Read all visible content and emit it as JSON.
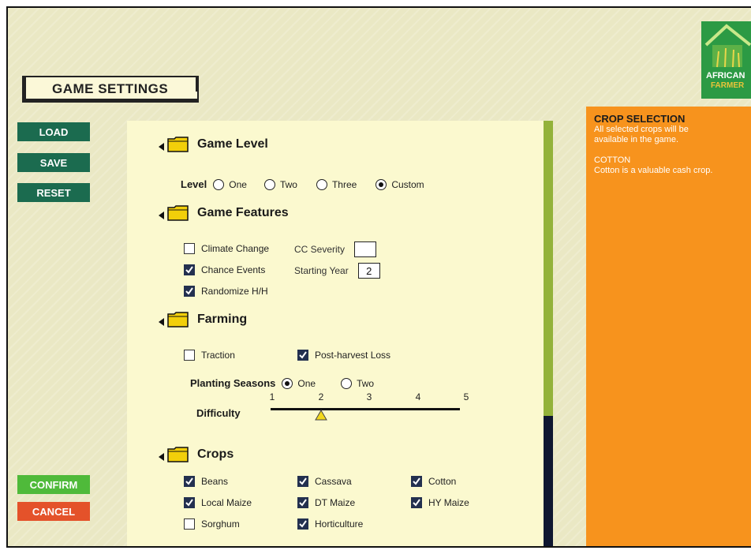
{
  "title": "GAME SETTINGS",
  "buttons": {
    "load": "LOAD",
    "save": "SAVE",
    "reset": "RESET",
    "confirm": "CONFIRM",
    "cancel": "CANCEL"
  },
  "game_level": {
    "heading": "Game Level",
    "label": "Level",
    "options": [
      "One",
      "Two",
      "Three",
      "Custom"
    ],
    "selected": "Custom"
  },
  "game_features": {
    "heading": "Game Features",
    "climate_change": {
      "label": "Climate Change",
      "checked": false
    },
    "chance_events": {
      "label": "Chance Events",
      "checked": true
    },
    "randomize": {
      "label": "Randomize H/H",
      "checked": true
    },
    "cc_severity": {
      "label": "CC Severity",
      "value": ""
    },
    "starting_year": {
      "label": "Starting Year",
      "value": "2"
    }
  },
  "farming": {
    "heading": "Farming",
    "traction": {
      "label": "Traction",
      "checked": false
    },
    "post_harvest": {
      "label": "Post-harvest Loss",
      "checked": true
    },
    "planting_seasons": {
      "label": "Planting Seasons",
      "options": [
        "One",
        "Two"
      ],
      "selected": "One"
    },
    "difficulty": {
      "label": "Difficulty",
      "ticks": [
        "1",
        "2",
        "3",
        "4",
        "5"
      ],
      "value": 2
    }
  },
  "crops": {
    "heading": "Crops",
    "items": [
      {
        "label": "Beans",
        "checked": true
      },
      {
        "label": "Cassava",
        "checked": true
      },
      {
        "label": "Cotton",
        "checked": true
      },
      {
        "label": "Local Maize",
        "checked": true
      },
      {
        "label": "DT Maize",
        "checked": true
      },
      {
        "label": "HY Maize",
        "checked": true
      },
      {
        "label": "Sorghum",
        "checked": false
      },
      {
        "label": "Horticulture",
        "checked": true
      }
    ]
  },
  "info_panel": {
    "title": "CROP SELECTION",
    "line1": "All selected crops will be",
    "line2": "available in the game.",
    "subtitle": "COTTON",
    "description": "Cotton is a valuable cash crop."
  },
  "logo": {
    "line1": "AFRICAN",
    "line2": "FARMER"
  },
  "colors": {
    "panel_bg": "#fbf9cf",
    "info_bg": "#f7931d",
    "button_green": "#1b6b4f",
    "confirm": "#4fba3a",
    "cancel": "#e4522a",
    "scroll_thumb": "#93b23a",
    "scroll_track": "#0e1630"
  },
  "icons": {
    "section": "folder-icon",
    "collapse": "triangle-left-icon",
    "slider": "triangle-up-icon"
  }
}
